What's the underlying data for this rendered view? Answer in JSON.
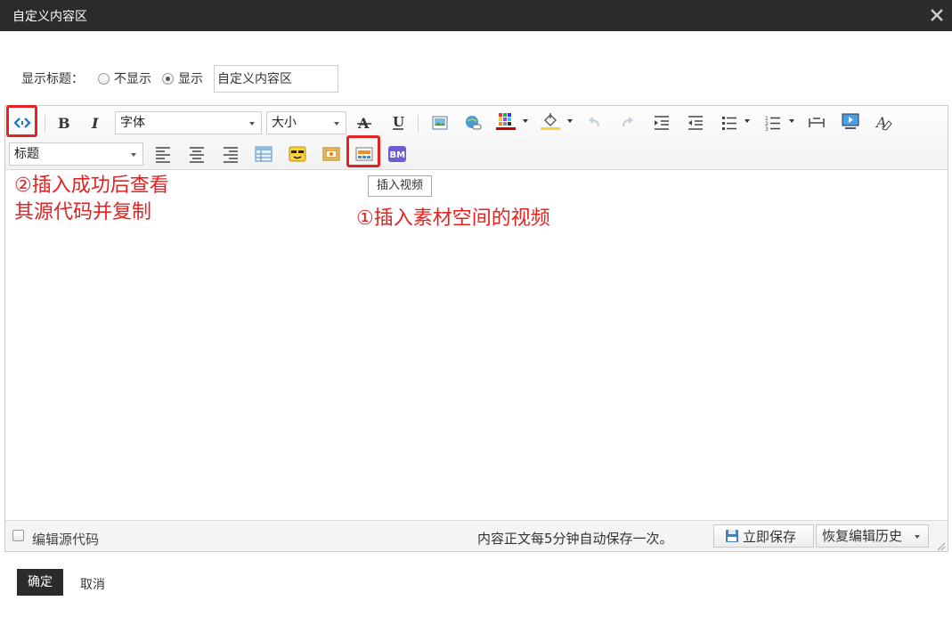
{
  "dialog": {
    "title": "自定义内容区"
  },
  "title_row": {
    "label": "显示标题：",
    "options": [
      "不显示",
      "显示"
    ],
    "selected": "显示",
    "input_value": "自定义内容区"
  },
  "toolbar": {
    "font_select": "字体",
    "size_select": "大小",
    "heading_select": "标题",
    "tooltip": "插入视频"
  },
  "annotations": {
    "note1": "①插入素材空间的视频",
    "note2_line1": "②插入成功后查看",
    "note2_line2": "其源代码并复制"
  },
  "statusbar": {
    "edit_source_label": "编辑源代码",
    "autosave_text": "内容正文每5分钟自动保存一次。",
    "save_now": "立即保存",
    "restore_history": "恢复编辑历史"
  },
  "footer": {
    "ok": "确定",
    "cancel": "取消"
  },
  "colors": {
    "titlebar": "#2b2b2b",
    "highlight": "#e52222"
  }
}
